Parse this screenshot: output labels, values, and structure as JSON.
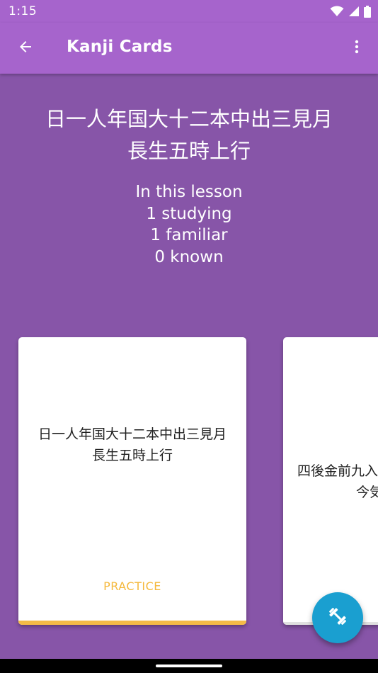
{
  "status_bar": {
    "time": "1:15",
    "icons": [
      "wifi-icon",
      "signal-icon",
      "battery-icon"
    ]
  },
  "app_bar": {
    "title": "Kanji Cards",
    "back_icon": "arrow-back-icon",
    "menu_icon": "more-vert-icon"
  },
  "lesson": {
    "kanji_line1": "日一人年国大十二本中出三見月",
    "kanji_line2": "長生五時上行",
    "stats": {
      "heading": "In this lesson",
      "studying": "1 studying",
      "familiar": "1 familiar",
      "known": "0 known"
    }
  },
  "cards": [
    {
      "kanji_line1": "日一人年国大十二本中出三見月",
      "kanji_line2": "長生五時上行",
      "action_label": "PRACTICE"
    },
    {
      "kanji_line1": "四後金前九入",
      "kanji_line2": "今気"
    }
  ],
  "fab": {
    "icon": "dumbbell-icon"
  },
  "colors": {
    "app_bar": "#a664cc",
    "background": "#8755a8",
    "accent": "#f5b93d",
    "fab": "#1a9fd0"
  }
}
